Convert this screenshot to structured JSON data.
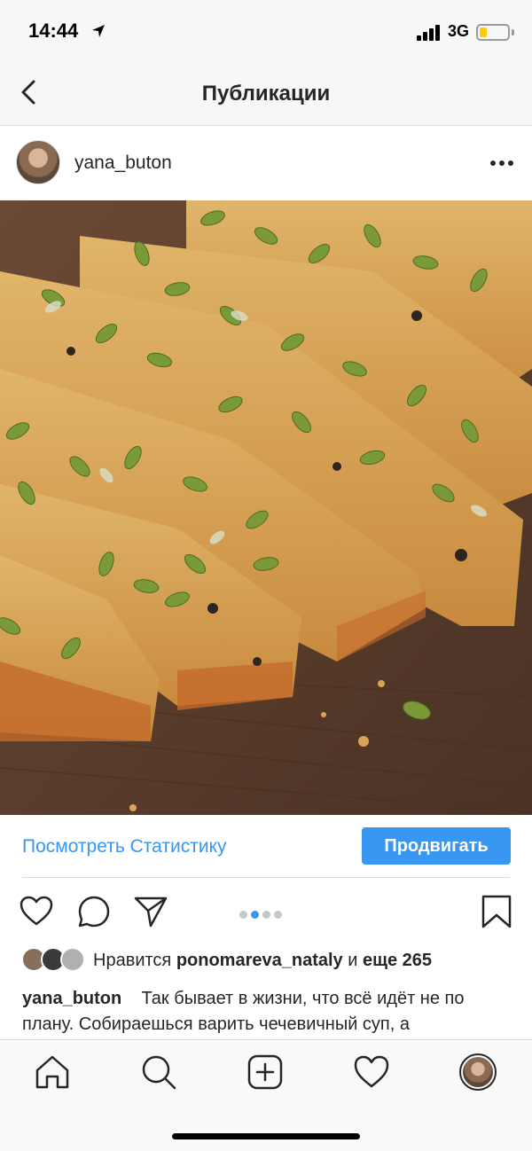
{
  "status_bar": {
    "time": "14:44",
    "network": "3G",
    "icons": [
      "location-arrow-icon",
      "signal-bars-icon",
      "battery-icon"
    ],
    "battery_color": "#ffcc00"
  },
  "nav": {
    "title": "Публикации",
    "back_icon": "chevron-left-icon"
  },
  "post": {
    "username": "yana_buton",
    "more_icon": "ellipsis-icon",
    "photo_alt": "",
    "promo": {
      "stats_link": "Посмотреть Статистику",
      "promote_button": "Продвигать"
    },
    "carousel": {
      "total": 4,
      "active": 2
    },
    "actions": [
      "heart-icon",
      "comment-icon",
      "share-icon",
      "bookmark-icon"
    ],
    "likes": {
      "prefix": "Нравится ",
      "user": "ponomareva_nataly",
      "middle": " и ",
      "rest": "еще 265"
    },
    "caption": {
      "user": "yana_buton",
      "text": "Так бывает в жизни, что всё идёт не по плану. Собираешься варить чечевичный суп, а"
    }
  },
  "tab_bar": {
    "items": [
      "home-icon",
      "search-icon",
      "add-post-icon",
      "activity-heart-icon",
      "profile-avatar"
    ]
  },
  "colors": {
    "accent": "#3897f0",
    "text": "#262626",
    "bar_bg": "#f7f7f7"
  }
}
